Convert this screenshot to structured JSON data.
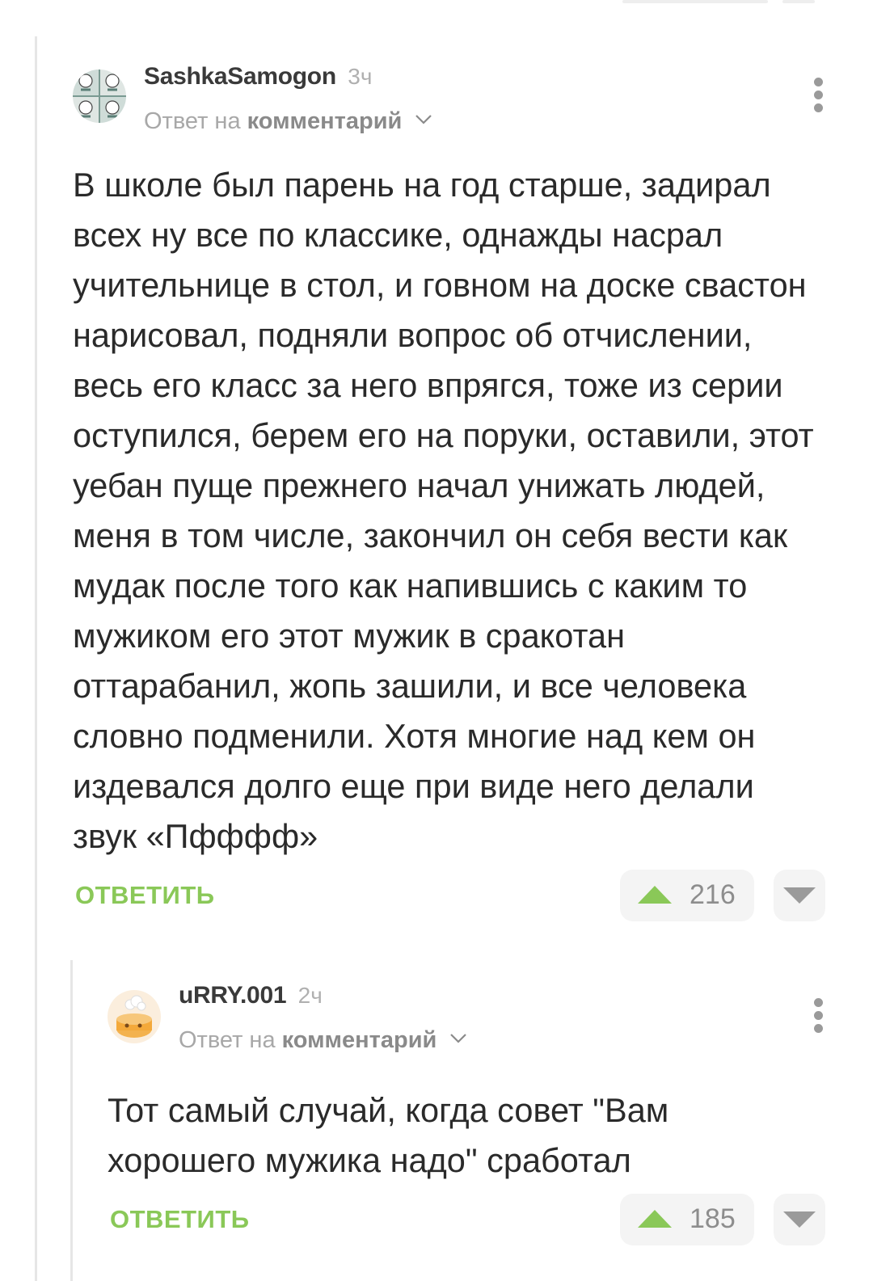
{
  "comments": [
    {
      "username": "SashkaSamogon",
      "time": "3ч",
      "reply_prefix": "Ответ на",
      "reply_link": "комментарий",
      "body": "В школе был парень на год старше, задирал всех ну все по классике, однажды насрал учительнице в стол, и говном на доске свастон нарисовал, подняли вопрос об отчислении, весь его класс за него впрягся, тоже из серии оступился, берем его на поруки, оставили, этот уебан пуще прежнего начал унижать людей, меня в том числе, закончил он себя вести как мудак после того как напившись с каким то мужиком его этот мужик в сракотан оттарабанил, жопь зашили, и все человека словно подменили. Хотя многие над кем он издевался долго еще при виде него делали звук «Пфффф»",
      "reply_button": "ОТВЕТИТЬ",
      "rating": "216",
      "avatar_icon": "meme-faces-avatar"
    },
    {
      "username": "uRRY.001",
      "time": "2ч",
      "reply_prefix": "Ответ на",
      "reply_link": "комментарий",
      "body": "Тот самый случай, когда совет \"Вам хорошего мужика надо\" сработал",
      "reply_button": "ОТВЕТИТЬ",
      "rating": "185",
      "avatar_icon": "cooking-pot-avatar"
    }
  ],
  "colors": {
    "accent_green": "#8ac858",
    "muted_text": "#a8a8a8",
    "vote_bg": "#f4f4f4"
  }
}
